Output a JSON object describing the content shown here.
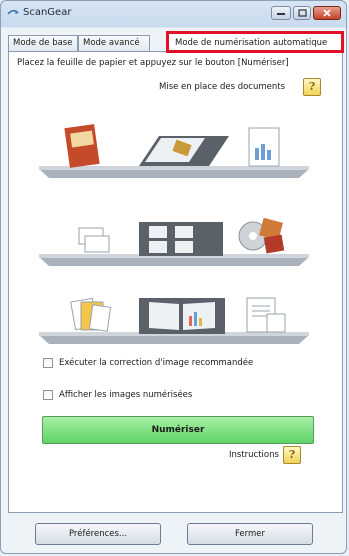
{
  "window": {
    "title": "ScanGear"
  },
  "tabs": [
    {
      "label": "Mode de base",
      "selected": false
    },
    {
      "label": "Mode avancé",
      "selected": false
    },
    {
      "label": "Mode de numérisation automatique",
      "selected": true
    }
  ],
  "panel": {
    "instruction": "Placez la feuille de papier et appuyez sur le bouton [Numériser]",
    "place_docs_label": "Mise en place des documents",
    "help_glyph": "?",
    "checkboxes": [
      {
        "label": "Exécuter la correction d'image recommandée",
        "checked": false
      },
      {
        "label": "Afficher les images numérisées",
        "checked": false
      }
    ],
    "scan_button": "Numériser",
    "instructions_label": "Instructions"
  },
  "footer": {
    "preferences_button": "Préférences...",
    "close_button": "Fermer"
  },
  "colors": {
    "highlight_border": "#e3102a",
    "scan_button": "#6ad96f",
    "help_button": "#f2d258"
  }
}
